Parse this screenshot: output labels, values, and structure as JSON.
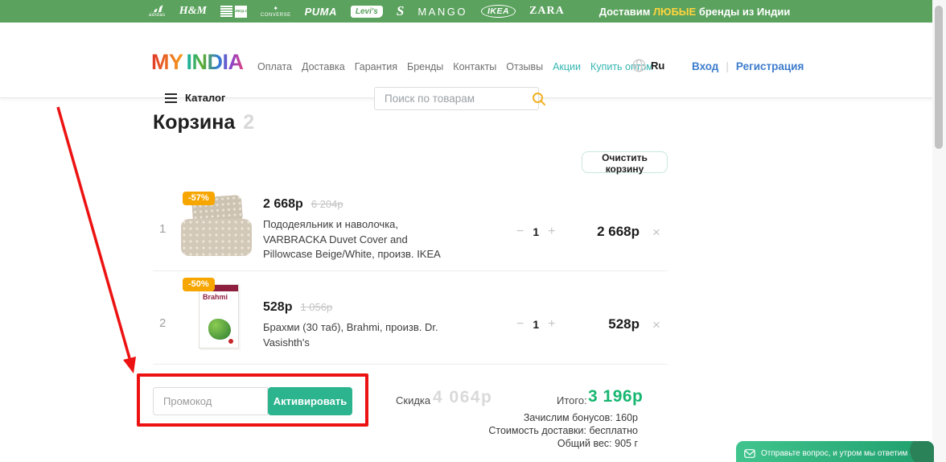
{
  "topbar": {
    "brands": [
      "adidas",
      "H&M",
      "UNIQLO",
      "CONVERSE",
      "PUMA",
      "Levi's",
      "S",
      "MANGO",
      "IKEA",
      "ZARA"
    ],
    "message_prefix": "Доставим ",
    "message_highlight": "ЛЮБЫЕ",
    "message_suffix": " бренды из Индии"
  },
  "header": {
    "logo_part1": "MY",
    "logo_part2": "INDIA",
    "nav": [
      "Оплата",
      "Доставка",
      "Гарантия",
      "Бренды",
      "Контакты",
      "Отзывы",
      "Акции",
      "Купить оптом"
    ],
    "language": "Ru",
    "login": "Вход",
    "divider": "|",
    "register": "Регистрация",
    "catalog_label": "Каталог",
    "search_placeholder": "Поиск по товарам"
  },
  "cart": {
    "title": "Корзина",
    "count": "2",
    "clear_button": "Очистить корзину",
    "items": [
      {
        "index": "1",
        "discount": "-57%",
        "price": "2 668р",
        "old_price": "6 204р",
        "description": "Пододеяльник и наволочка, VARBRACKA Duvet Cover and Pillowcase Beige/White, произв. IKEA",
        "qty": "1",
        "total": "2 668р"
      },
      {
        "index": "2",
        "discount": "-50%",
        "price": "528р",
        "old_price": "1 056р",
        "description": "Брахми (30 таб), Brahmi, произв. Dr. Vasishth's",
        "qty": "1",
        "total": "528р",
        "image_text": "Brahmi"
      }
    ]
  },
  "summary": {
    "promo_placeholder": "Промокод",
    "promo_button": "Активировать",
    "discount_label": "Скидка",
    "discount_value": "4 064р",
    "total_label": "Итого:",
    "total_value": "3 196р",
    "notes": [
      "Зачислим бонусов: 160р",
      "Стоимость доставки: бесплатно",
      "Общий вес: 905 г"
    ]
  },
  "chat": {
    "message": "Отправьте вопрос, и утром мы ответим вам!"
  },
  "icons": {
    "minus": "−",
    "plus": "+",
    "remove": "×",
    "star": "✦"
  },
  "colors": {
    "topbar_green": "#5ba25e",
    "highlight_yellow": "#ffd53e",
    "accent_teal": "#35b7b2",
    "link_blue": "#3d7ccc",
    "badge_orange": "#f7a600",
    "price_green": "#17b671",
    "button_green": "#2cb48e",
    "annotation_red": "#ed1212"
  }
}
